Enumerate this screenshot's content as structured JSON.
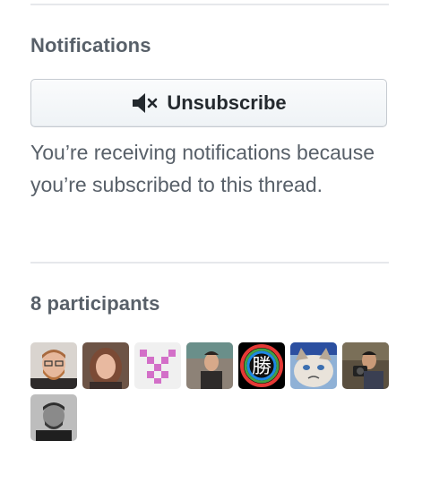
{
  "notifications": {
    "title": "Notifications",
    "unsubscribe_label": "Unsubscribe",
    "unsubscribe_icon": "mute-icon",
    "reason": "You’re receiving notifications because you’re subscribed to this thread."
  },
  "participants": {
    "title": "8 participants",
    "avatars": [
      {
        "name": "avatar-person-bearded-glasses",
        "bg": "#d9d4cf"
      },
      {
        "name": "avatar-person-woman",
        "bg": "#6d5446"
      },
      {
        "name": "avatar-identicon-pink",
        "bg": "#f0f0f0",
        "color": "#d36fc8"
      },
      {
        "name": "avatar-person-in-shop",
        "bg": "#8d8277"
      },
      {
        "name": "avatar-kanji-rainbow",
        "bg": "#000000",
        "text": "勝"
      },
      {
        "name": "avatar-grumpy-cat",
        "bg": "#8fb1d6"
      },
      {
        "name": "avatar-person-with-camera",
        "bg": "#5a4f3f"
      },
      {
        "name": "avatar-person-grayscale",
        "bg": "#bdbdbd"
      }
    ]
  }
}
